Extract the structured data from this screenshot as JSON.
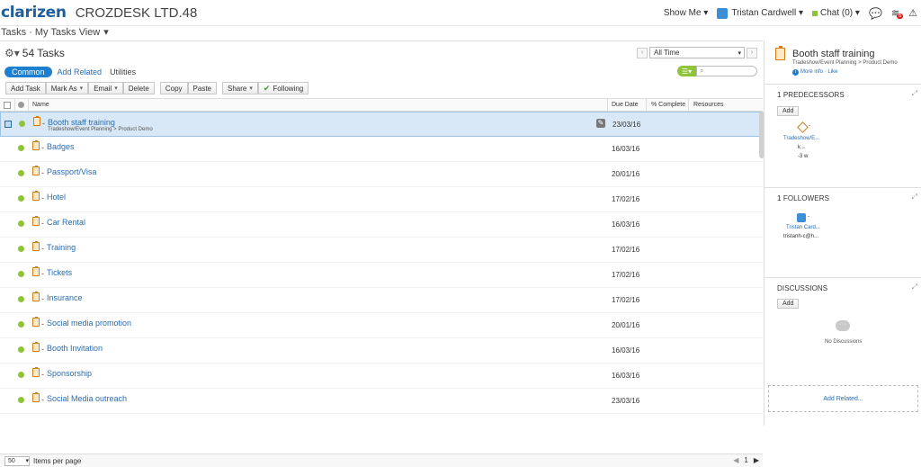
{
  "header": {
    "logo": "clarizen",
    "company": "CROZDESK LTD.48",
    "show_me": "Show Me",
    "user": "Tristan Cardwell",
    "chat": "Chat (0)",
    "notif_count": "6"
  },
  "view": {
    "title": "Tasks · My Tasks View"
  },
  "tasks_header": {
    "count_label": "54 Tasks"
  },
  "tabs": [
    {
      "label": "Common"
    },
    {
      "label": "Add Related"
    },
    {
      "label": "Utilities"
    }
  ],
  "toolbar": {
    "add_task": "Add Task",
    "mark_as": "Mark As",
    "email": "Email",
    "delete": "Delete",
    "copy": "Copy",
    "paste": "Paste",
    "share": "Share",
    "following": "Following"
  },
  "filter": {
    "time": "All Time"
  },
  "columns": {
    "name": "Name",
    "due_date": "Due Date",
    "pct": "% Complete",
    "resources": "Resources"
  },
  "rows": [
    {
      "name": "Booth staff training",
      "sub": "Tradeshow/Event Planning > Product Demo",
      "due": "23/03/16",
      "selected": true
    },
    {
      "name": "Badges",
      "due": "16/03/16"
    },
    {
      "name": "Passport/Visa",
      "due": "20/01/16"
    },
    {
      "name": "Hotel",
      "due": "17/02/16"
    },
    {
      "name": "Car Rental",
      "due": "16/03/16"
    },
    {
      "name": "Training",
      "due": "17/02/16"
    },
    {
      "name": "Tickets",
      "due": "17/02/16"
    },
    {
      "name": "Insurance",
      "due": "17/02/16"
    },
    {
      "name": "Social media promotion",
      "due": "20/01/16"
    },
    {
      "name": "Booth Invitation",
      "due": "16/03/16"
    },
    {
      "name": "Sponsorship",
      "due": "16/03/16"
    },
    {
      "name": "Social Media outreach",
      "due": "23/03/16"
    }
  ],
  "footer": {
    "per_page": "50",
    "items_label": "Items per page",
    "page": "1"
  },
  "panel": {
    "title": "Booth staff training",
    "path": "Tradeshow/Event Planning > Product Demo",
    "more_info": "More info",
    "like": "Like",
    "predecessors": {
      "title": "1 PREDECESSORS",
      "add": "Add",
      "item": "Tradeshow/E...",
      "rel": "k→",
      "lag": "-3 w"
    },
    "followers": {
      "title": "1 FOLLOWERS",
      "name": "Tristan Card...",
      "email": "tristanh-c@h..."
    },
    "discussions": {
      "title": "DISCUSSIONS",
      "add": "Add",
      "empty": "No Discussions"
    },
    "add_related": "Add Related..."
  }
}
